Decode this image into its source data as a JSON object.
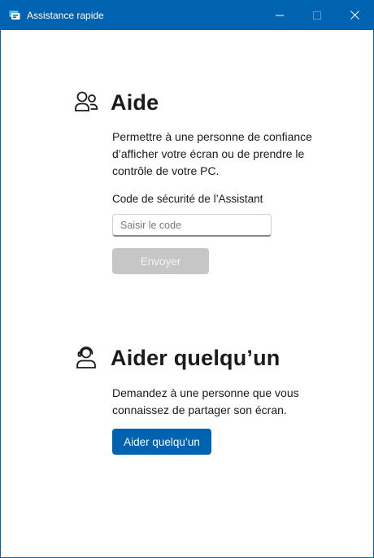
{
  "window": {
    "title": "Assistance rapide",
    "icon": "quick-assist-icon",
    "accent_color": "#0063b1",
    "controls": {
      "minimize": "minimize-icon",
      "maximize": "maximize-icon",
      "close": "close-icon"
    }
  },
  "get_help": {
    "icon": "people-icon",
    "title": "Aide",
    "description": "Permettre à une personne de confiance d’afficher votre écran ou de prendre le contrôle de votre PC.",
    "code_label": "Code de sécurité de l’Assistant",
    "code_value": "",
    "code_placeholder": "Saisir le code",
    "submit_label": "Envoyer"
  },
  "give_help": {
    "icon": "person-support-icon",
    "title": "Aider quelqu’un",
    "description": "Demandez à une personne que vous connaissez de partager son écran.",
    "button_label": "Aider quelqu’un"
  }
}
